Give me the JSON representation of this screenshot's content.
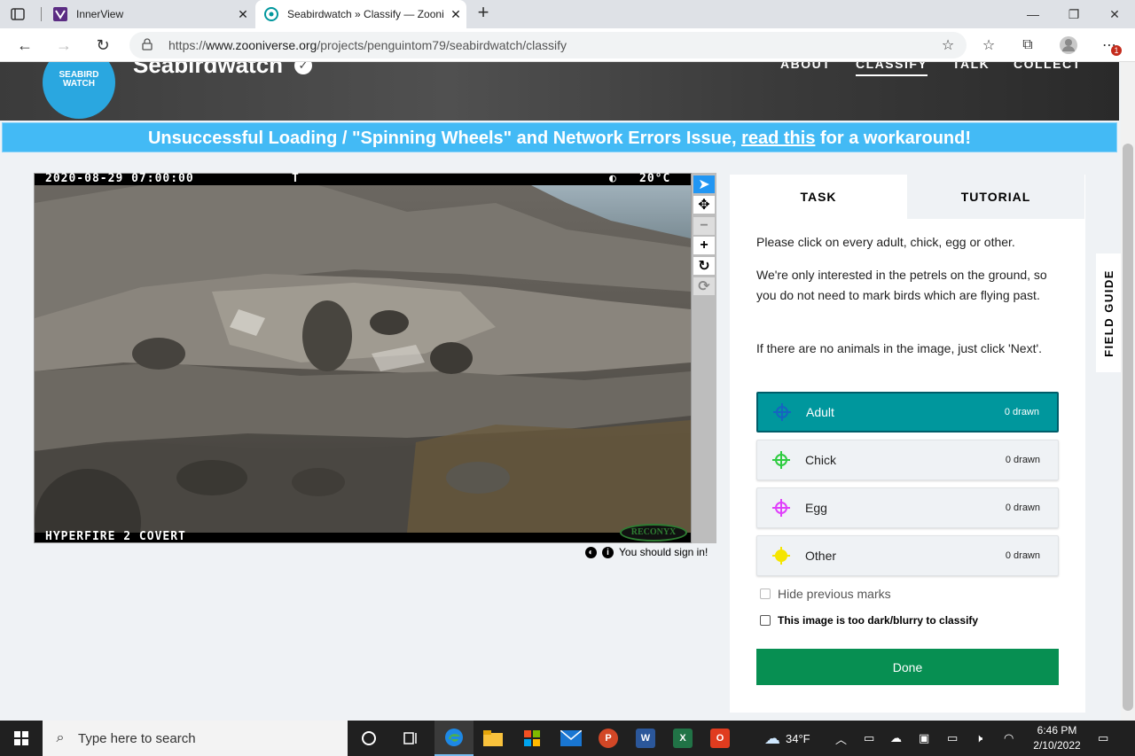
{
  "browser": {
    "tabs": [
      {
        "title": "InnerView",
        "icon": "innerview-favicon",
        "active": false
      },
      {
        "title": "Seabirdwatch » Classify — Zooni",
        "icon": "zooniverse-favicon",
        "active": true
      }
    ],
    "url_prefix": "https://",
    "url_host": "www.zooniverse.org",
    "url_path": "/projects/penguintom79/seabirdwatch/classify",
    "notification_badge": "1"
  },
  "header": {
    "logo_text_1": "SEABIRD",
    "logo_text_2": "WATCH",
    "project_name": "Seabirdwatch",
    "nav": [
      {
        "label": "ABOUT",
        "active": false
      },
      {
        "label": "CLASSIFY",
        "active": true
      },
      {
        "label": "TALK",
        "active": false
      },
      {
        "label": "COLLECT",
        "active": false
      }
    ]
  },
  "banner": {
    "text_before": "Unsuccessful Loading / \"Spinning Wheels\" and Network Errors Issue, ",
    "link": "read this",
    "text_after": " for a workaround!"
  },
  "subject": {
    "timestamp": "2020-08-29 07:00:00",
    "marker": "T",
    "temperature": "20°C",
    "camera_model": "HYPERFIRE 2 COVERT",
    "brand": "RECONYX",
    "sign_in_note": "You should sign in!"
  },
  "task_panel": {
    "tabs": [
      "TASK",
      "TUTORIAL"
    ],
    "instructions": [
      "Please click on every adult, chick, egg or other.",
      "We're only interested in the petrels on the ground, so you do not need to mark birds which are flying past.",
      "If there are no animals in the image, just click 'Next'."
    ],
    "tools": [
      {
        "label": "Adult",
        "count": "0 drawn",
        "color": "#1565c0",
        "active": true
      },
      {
        "label": "Chick",
        "count": "0 drawn",
        "color": "#2ecc40",
        "active": false
      },
      {
        "label": "Egg",
        "count": "0 drawn",
        "color": "#e040fb",
        "active": false
      },
      {
        "label": "Other",
        "count": "0 drawn",
        "color": "#f5e500",
        "active": false
      }
    ],
    "hide_marks_label": "Hide previous marks",
    "too_dark_label": "This image is too dark/blurry to classify",
    "done_label": "Done",
    "field_guide": "FIELD GUIDE"
  },
  "taskbar": {
    "search_placeholder": "Type here to search",
    "weather": "34°F",
    "time": "6:46 PM",
    "date": "2/10/2022"
  },
  "colors": {
    "banner": "#43baf5",
    "active_tool": "#00979d",
    "done": "#078f52"
  }
}
